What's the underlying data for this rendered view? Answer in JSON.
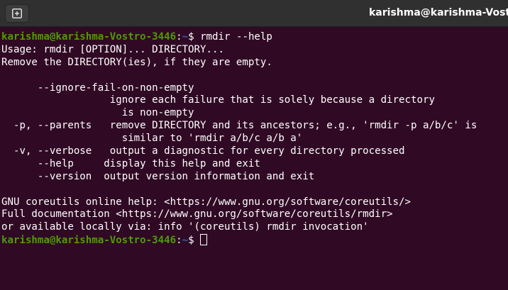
{
  "window": {
    "title": "karishma@karishma-Vostro"
  },
  "prompt": {
    "user_host": "karishma@karishma-Vostro-3446",
    "separator": ":",
    "path": "~",
    "symbol": "$ "
  },
  "commands": {
    "first": "rmdir --help",
    "second": ""
  },
  "output": [
    "Usage: rmdir [OPTION]... DIRECTORY...",
    "Remove the DIRECTORY(ies), if they are empty.",
    "",
    "      --ignore-fail-on-non-empty",
    "                  ignore each failure that is solely because a directory",
    "                    is non-empty",
    "  -p, --parents   remove DIRECTORY and its ancestors; e.g., 'rmdir -p a/b/c' is",
    "                    similar to 'rmdir a/b/c a/b a'",
    "  -v, --verbose   output a diagnostic for every directory processed",
    "      --help     display this help and exit",
    "      --version  output version information and exit",
    "",
    "GNU coreutils online help: <https://www.gnu.org/software/coreutils/>",
    "Full documentation <https://www.gnu.org/software/coreutils/rmdir>",
    "or available locally via: info '(coreutils) rmdir invocation'"
  ],
  "icons": {
    "new_tab": "new-tab-icon"
  },
  "colors": {
    "background": "#300a24",
    "prompt_user": "#4e9a06",
    "prompt_path": "#3465a4",
    "titlebar": "#303030"
  }
}
